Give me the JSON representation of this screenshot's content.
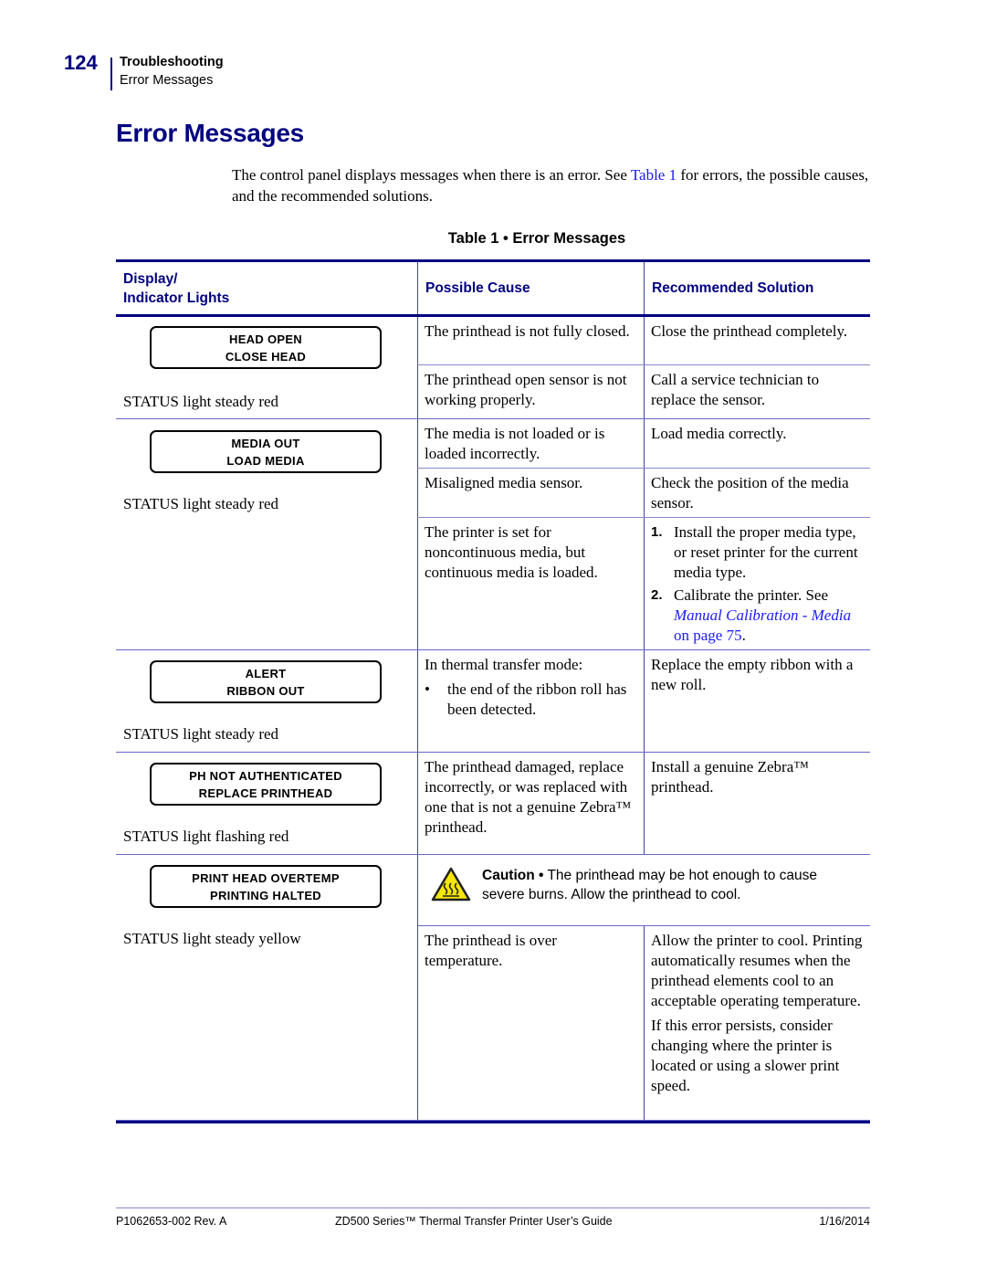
{
  "header": {
    "page_number": "124",
    "chapter": "Troubleshooting",
    "section": "Error Messages"
  },
  "title": "Error Messages",
  "intro": {
    "before_link": "The control panel displays messages when there is an error. See ",
    "link": "Table 1",
    "after_link": " for errors, the possible causes, and the recommended solutions."
  },
  "table": {
    "caption": "Table 1 • Error Messages",
    "headers": {
      "display_line1": "Display/",
      "display_line2": "Indicator Lights",
      "cause": "Possible Cause",
      "solution": "Recommended Solution"
    },
    "groups": [
      {
        "lcd": [
          "HEAD OPEN",
          "CLOSE HEAD"
        ],
        "status": "STATUS light steady red",
        "rows": [
          {
            "cause": "The printhead is not fully closed.",
            "solution": "Close the printhead completely."
          },
          {
            "cause": "The printhead open sensor is not working properly.",
            "solution": "Call a service technician to replace the sensor."
          }
        ]
      },
      {
        "lcd": [
          "MEDIA OUT",
          "LOAD MEDIA"
        ],
        "status": "STATUS light steady red",
        "rows": [
          {
            "cause": "The media is not loaded or is loaded incorrectly.",
            "solution": "Load media correctly."
          },
          {
            "cause": "Misaligned media sensor.",
            "solution": "Check the position of the media sensor."
          },
          {
            "cause": "The printer is set for noncontinuous media, but continuous media is loaded.",
            "steps": [
              {
                "num": "1.",
                "text": "Install the proper media type, or reset printer for the current media type."
              },
              {
                "num": "2.",
                "text": "Calibrate the printer. See ",
                "link": "Manual Calibration - Media",
                "after": " on page 75",
                "end": "."
              }
            ]
          }
        ]
      },
      {
        "lcd": [
          "ALERT",
          "RIBBON OUT"
        ],
        "status": "STATUS light steady red",
        "rows": [
          {
            "cause": "In thermal transfer mode:",
            "bullet": "the end of the ribbon roll has been detected.",
            "solution": "Replace the empty ribbon with a new roll."
          }
        ]
      },
      {
        "lcd": [
          "PH NOT AUTHENTICATED",
          "REPLACE PRINTHEAD"
        ],
        "status": "STATUS light flashing red",
        "rows": [
          {
            "cause": "The printhead damaged, replace incorrectly, or was replaced with one that is not a genuine Zebra™ printhead.",
            "solution": "Install a genuine Zebra™ printhead."
          }
        ]
      },
      {
        "lcd": [
          "PRINT HEAD OVERTEMP",
          "PRINTING HALTED"
        ],
        "status": "STATUS light steady yellow",
        "caution": {
          "label": "Caution •",
          "text": " The printhead may be hot enough to cause severe burns. Allow the printhead to cool.",
          "icon": "hot-surface-warning-icon"
        },
        "rows": [
          {
            "cause": "The printhead is over temperature.",
            "solution": "Allow the printer to cool. Printing automatically resumes when the printhead elements cool to an acceptable operating temperature.",
            "solution2": "If this error persists, consider changing where the printer is located or using a slower print speed."
          }
        ]
      }
    ]
  },
  "footer": {
    "doc_number": "P1062653-002 Rev. A",
    "guide_title": "ZD500 Series™ Thermal Transfer Printer User’s Guide",
    "date": "1/16/2014"
  },
  "colors": {
    "brand_navy": "#000080",
    "link_blue": "#1a1aff",
    "caution_yellow": "#f5e60a"
  }
}
